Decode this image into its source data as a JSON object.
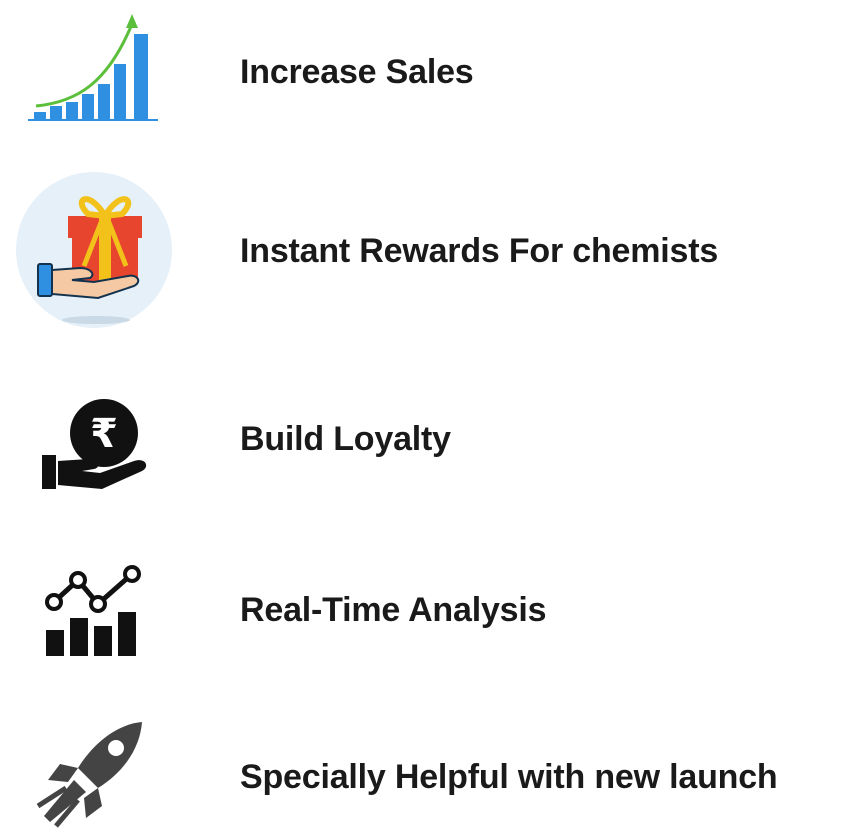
{
  "features": [
    {
      "label": "Increase Sales",
      "icon": "rising-bar-chart-icon"
    },
    {
      "label": "Instant Rewards For chemists",
      "icon": "gift-in-hand-icon"
    },
    {
      "label": "Build Loyalty",
      "icon": "rupee-coin-hand-icon"
    },
    {
      "label": "Real-Time Analysis",
      "icon": "line-bar-analytics-icon"
    },
    {
      "label": "Specially Helpful with new launch",
      "icon": "rocket-icon"
    }
  ],
  "colors": {
    "text": "#1a1a1a",
    "chart_blue": "#2f8fe0",
    "arrow_green": "#5cbf3c",
    "gift_red": "#e8452e",
    "ribbon_yellow": "#f2c21b",
    "badge_bg": "#e6f0f8",
    "icon_black": "#111111",
    "rocket_gray": "#444444"
  }
}
